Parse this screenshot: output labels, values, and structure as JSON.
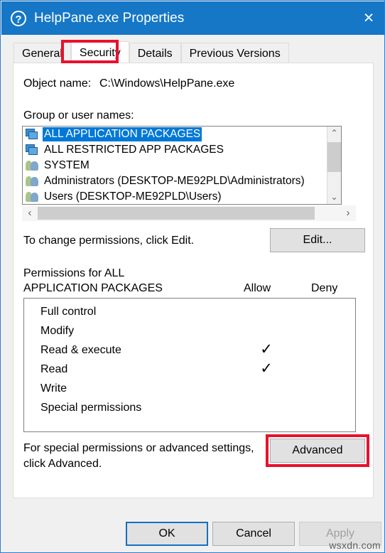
{
  "window": {
    "title": "HelpPane.exe Properties",
    "help_icon": "question-mark-icon",
    "close_icon": "×"
  },
  "tabs": [
    {
      "label": "General",
      "active": false
    },
    {
      "label": "Security",
      "active": true
    },
    {
      "label": "Details",
      "active": false
    },
    {
      "label": "Previous Versions",
      "active": false
    }
  ],
  "security": {
    "object_name_label": "Object name:",
    "object_name_value": "C:\\Windows\\HelpPane.exe",
    "groups_label": "Group or user names:",
    "groups": [
      {
        "name": "ALL APPLICATION PACKAGES",
        "icon": "package-icon",
        "selected": true
      },
      {
        "name": "ALL RESTRICTED APP PACKAGES",
        "icon": "package-icon",
        "selected": false
      },
      {
        "name": "SYSTEM",
        "icon": "users-icon",
        "selected": false
      },
      {
        "name": "Administrators (DESKTOP-ME92PLD\\Administrators)",
        "icon": "users-icon",
        "selected": false
      },
      {
        "name": "Users (DESKTOP-ME92PLD\\Users)",
        "icon": "users-icon",
        "selected": false
      }
    ],
    "edit_hint": "To change permissions, click Edit.",
    "edit_button": "Edit...",
    "permissions_title_line1": "Permissions for ALL",
    "permissions_title_line2": "APPLICATION PACKAGES",
    "column_allow": "Allow",
    "column_deny": "Deny",
    "permissions": [
      {
        "name": "Full control",
        "allow": false,
        "deny": false
      },
      {
        "name": "Modify",
        "allow": false,
        "deny": false
      },
      {
        "name": "Read & execute",
        "allow": true,
        "deny": false
      },
      {
        "name": "Read",
        "allow": true,
        "deny": false
      },
      {
        "name": "Write",
        "allow": false,
        "deny": false
      },
      {
        "name": "Special permissions",
        "allow": false,
        "deny": false
      }
    ],
    "check_glyph": "✓",
    "advanced_hint_line1": "For special permissions or advanced settings,",
    "advanced_hint_line2": "click Advanced.",
    "advanced_button": "Advanced"
  },
  "scrollbars": {
    "vertical_up": "⌃",
    "vertical_down": "⌄",
    "horizontal_left": "‹",
    "horizontal_right": "›"
  },
  "footer": {
    "ok": "OK",
    "cancel": "Cancel",
    "apply": "Apply"
  },
  "watermark": "wsxdn.com",
  "colors": {
    "titlebar": "#1577c6",
    "selection": "#0078d7",
    "annotation_red": "#e8112d",
    "focus_blue": "#1670c0",
    "dialog_bg": "#f0f0f0"
  }
}
